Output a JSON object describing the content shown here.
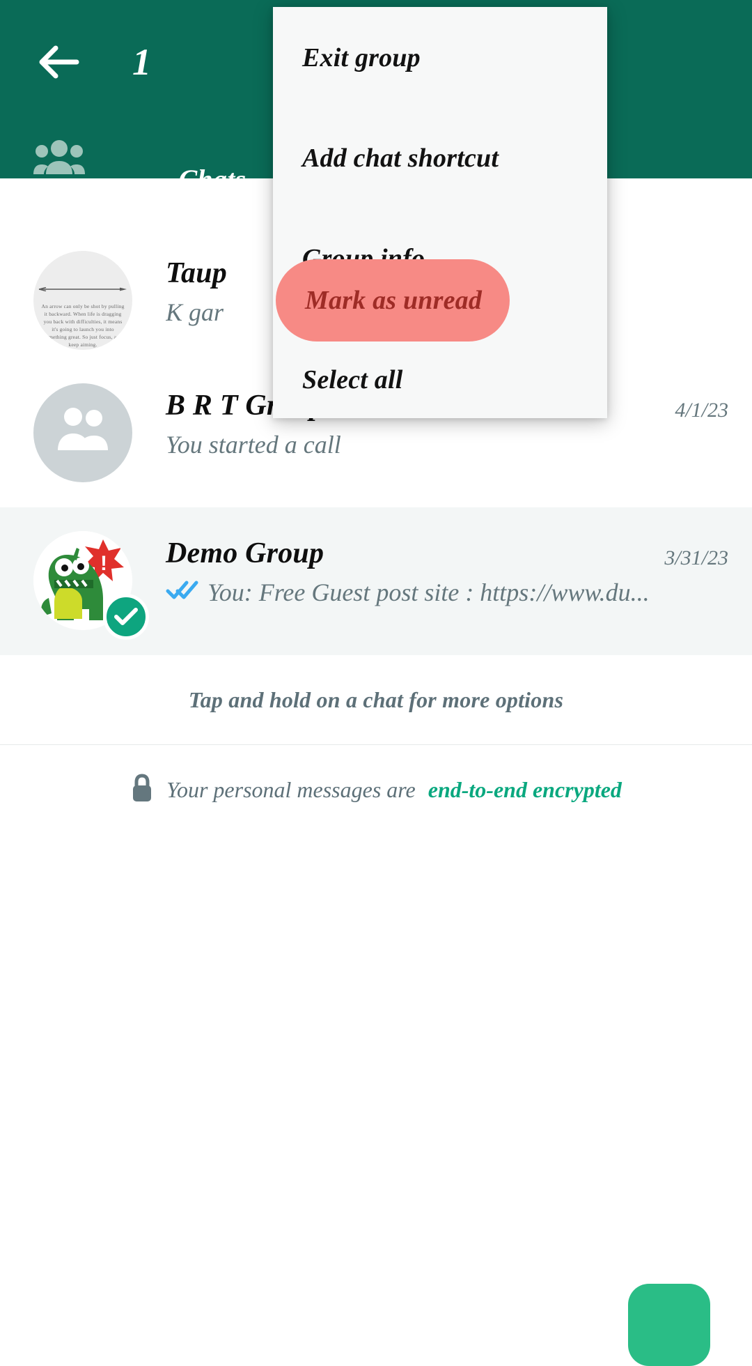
{
  "header": {
    "back_icon": "arrow-left-icon",
    "selection_count": "1",
    "tabs": [
      {
        "icon": "people-group-icon",
        "label": ""
      },
      {
        "icon": "",
        "label": "Chats"
      }
    ]
  },
  "menu": {
    "items": [
      {
        "label": "Exit group",
        "highlighted": false
      },
      {
        "label": "Add chat shortcut",
        "highlighted": false
      },
      {
        "label": "Group info",
        "highlighted": false
      },
      {
        "label": "Mark as unread",
        "highlighted": true
      },
      {
        "label": "Select all",
        "highlighted": false
      }
    ],
    "highlight_color": "#f78a85",
    "highlight_text_color": "#9e2c26"
  },
  "chats": [
    {
      "title": "Taup",
      "subtitle": "K gar",
      "time": "",
      "avatar": "arrow-quote-photo",
      "selected": false,
      "ticks": "",
      "quote_text": "An arrow can only be shot by pulling it backward. When life is dragging you back with difficulties, it means it's going to launch you into something great. So just focus, and keep aiming."
    },
    {
      "title": "B R T Group",
      "subtitle": "You started a call",
      "time": "4/1/23",
      "avatar": "default-group-icon",
      "selected": false,
      "ticks": ""
    },
    {
      "title": "Demo Group",
      "subtitle": "You: Free Guest post site :  https://www.du...",
      "time": "3/31/23",
      "avatar": "dinosaur-photo",
      "selected": true,
      "ticks": "double-check-blue-icon"
    }
  ],
  "footer": {
    "hint": "Tap and hold on a chat for more options",
    "encryption_prefix": "Your personal messages are",
    "encryption_link": "end-to-end encrypted",
    "lock_icon": "lock-icon",
    "fab_icon": "new-chat-fab"
  },
  "colors": {
    "header_green": "#0a6b57",
    "accent_green": "#0aa87f",
    "selected_row": "#f3f6f6"
  }
}
